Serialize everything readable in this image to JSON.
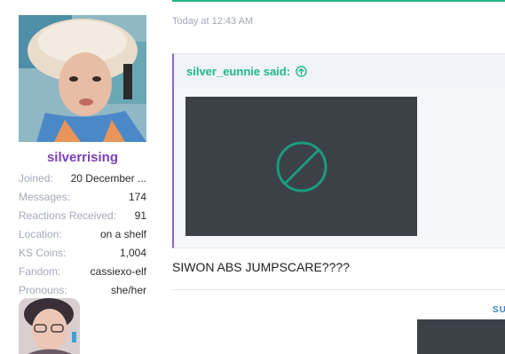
{
  "user": {
    "username": "silverrising",
    "stats": [
      {
        "label": "Joined:",
        "value": "20 December ..."
      },
      {
        "label": "Messages:",
        "value": "174"
      },
      {
        "label": "Reactions Received:",
        "value": "91"
      },
      {
        "label": "Location:",
        "value": "on a shelf"
      },
      {
        "label": "KS Coins:",
        "value": "1,004"
      },
      {
        "label": "Fandom:",
        "value": "cassiexo-elf"
      },
      {
        "label": "Pronouns:",
        "value": "she/her"
      }
    ]
  },
  "post": {
    "timestamp": "Today at 12:43 AM",
    "quote": {
      "author_line": "silver_eunnie said:",
      "jump_icon": "arrow-up-circle-icon",
      "media_icon": "blocked-media-icon"
    },
    "body": "SIWON ABS JUMPSCARE????"
  },
  "next_post": {
    "partial_mark": "SU"
  },
  "colors": {
    "accent_green": "#1fb88a",
    "username_purple": "#7a3fb8",
    "quote_border": "#8b64c8",
    "media_bg": "#3c4047",
    "stat_label": "#a3aab8"
  }
}
